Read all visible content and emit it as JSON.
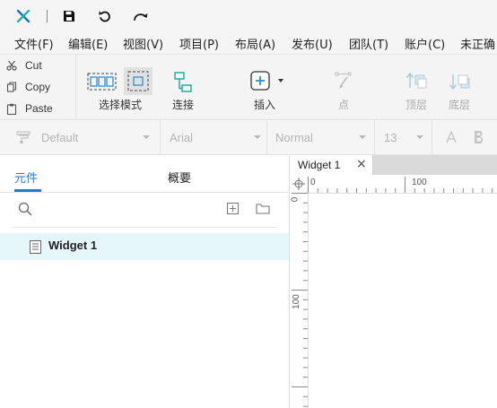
{
  "titlebar": {
    "logo": "axure-logo-icon",
    "buttons": [
      "save-icon",
      "undo-icon",
      "redo-icon"
    ]
  },
  "menu": {
    "items": [
      "文件(F)",
      "编辑(E)",
      "视图(V)",
      "项目(P)",
      "布局(A)",
      "发布(U)",
      "团队(T)",
      "账户(C)",
      "未正确"
    ]
  },
  "clipboard": {
    "cut": "Cut",
    "copy": "Copy",
    "paste": "Paste"
  },
  "toolbar": {
    "select_mode": "选择模式",
    "connect": "连接",
    "insert": "插入",
    "point": "点",
    "top_layer": "顶层",
    "bottom_layer": "底层"
  },
  "formatbar": {
    "style": "Default",
    "font": "Arial",
    "weight": "Normal",
    "size": "13"
  },
  "leftpane": {
    "tabs": [
      "元件",
      "概要"
    ],
    "widget_item": "Widget 1"
  },
  "canvas": {
    "tab_title": "Widget 1",
    "tab_close": "×",
    "hruler_labels": [
      "0",
      "100"
    ],
    "vruler_labels": [
      "0",
      "100"
    ]
  },
  "colors": {
    "accent": "#1f7bd6",
    "selection_bg": "#e6f7fb",
    "toolbar_icon": "#2a8fd6",
    "connect_icon": "#16a7a0"
  }
}
